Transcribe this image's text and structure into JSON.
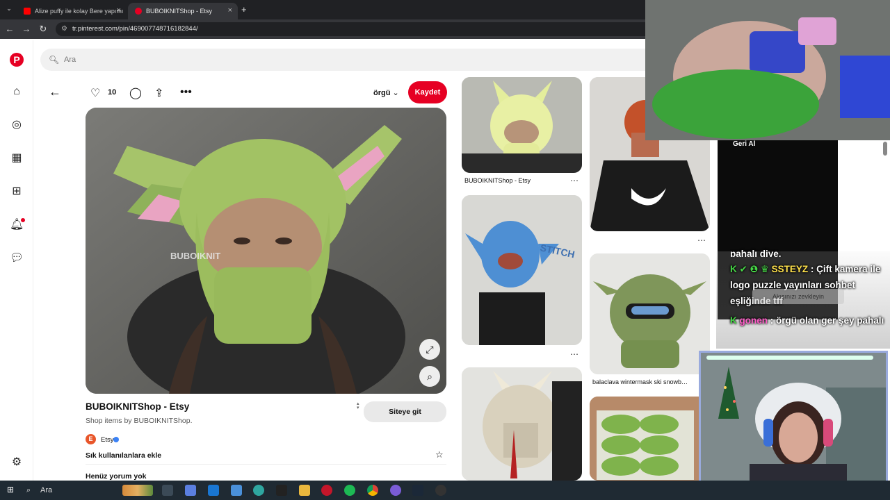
{
  "browser": {
    "tabs": [
      {
        "title": "Alize puffy ile kolay Bere yapımı",
        "active": false,
        "favicon_color": "#ff0000"
      },
      {
        "title": "BUBOIKNITShop - Etsy",
        "active": true,
        "favicon_color": "#e60023"
      }
    ],
    "url": "tr.pinterest.com/pin/469007748716182844/"
  },
  "pinterest": {
    "search_placeholder": "Ara",
    "like_count": "10",
    "board_name": "örgü",
    "save_label": "Kaydet",
    "image_watermark": "BUBOIKNIT",
    "pin_title": "BUBOIKNITShop - Etsy",
    "pin_description": "Shop items by BUBOIKNITShop.",
    "visit_label": "Siteye git",
    "source_name": "Etsy",
    "source_initial": "E",
    "add_favorites_label": "Sık kullanılanlara ekle",
    "comments_label": "Henüz yorum yok",
    "accent_color": "#e60023"
  },
  "grid": {
    "card1_caption": "BUBOIKNITShop - Etsy",
    "card2_text": "STITCH",
    "card3_caption": "balaclava wintermask ski snowb…"
  },
  "stream": {
    "chat_undo": "Geri Al",
    "chat_overlay_partial": "pahalı diye.",
    "chat_messages": [
      {
        "user": "SSTEYZ",
        "text": "Çift kamera ile logo puzzle yayınları sohbet eşliğinde tff"
      },
      {
        "user": "gonen",
        "text": "örgü olan ger şey pahalı"
      }
    ],
    "chat_hint": "Akışınızı zevkleyin"
  },
  "taskbar": {
    "search_label": "Ara"
  }
}
